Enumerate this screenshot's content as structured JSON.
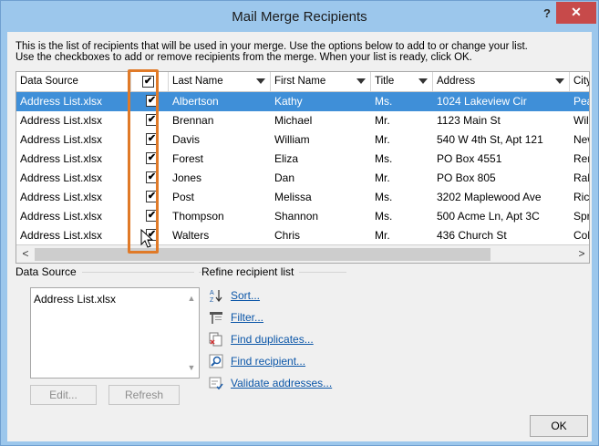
{
  "window": {
    "title": "Mail Merge Recipients",
    "help_label": "?",
    "close_label": "✕"
  },
  "intro_text": [
    "This is the list of recipients that will be used in your merge.  Use the options below to add to or change your list.",
    "Use the checkboxes to add or remove recipients from the merge.  When your list is ready, click OK."
  ],
  "table": {
    "columns": [
      "Data Source",
      "",
      "Last Name",
      "First Name",
      "Title",
      "Address",
      "City"
    ],
    "rows": [
      {
        "source": "Address List.xlsx",
        "checked": "✔",
        "last": "Albertson",
        "first": "Kathy",
        "title": "Ms.",
        "address": "1024 Lakeview Cir",
        "city": "Peacht"
      },
      {
        "source": "Address List.xlsx",
        "checked": "✔",
        "last": "Brennan",
        "first": "Michael",
        "title": "Mr.",
        "address": "1123 Main St",
        "city": "Wilmin"
      },
      {
        "source": "Address List.xlsx",
        "checked": "✔",
        "last": "Davis",
        "first": "William",
        "title": "Mr.",
        "address": "540 W 4th St, Apt 121",
        "city": "New Y"
      },
      {
        "source": "Address List.xlsx",
        "checked": "✔",
        "last": "Forest",
        "first": "Eliza",
        "title": "Ms.",
        "address": "PO Box 4551",
        "city": "Reno"
      },
      {
        "source": "Address List.xlsx",
        "checked": "✔",
        "last": "Jones",
        "first": "Dan",
        "title": "Mr.",
        "address": "PO Box 805",
        "city": "Raleigh"
      },
      {
        "source": "Address List.xlsx",
        "checked": "✔",
        "last": "Post",
        "first": "Melissa",
        "title": "Ms.",
        "address": "3202 Maplewood Ave",
        "city": "Richm"
      },
      {
        "source": "Address List.xlsx",
        "checked": "✔",
        "last": "Thompson",
        "first": "Shannon",
        "title": "Ms.",
        "address": "500 Acme Ln, Apt 3C",
        "city": "Spring"
      },
      {
        "source": "Address List.xlsx",
        "checked": "✔",
        "last": "Walters",
        "first": "Chris",
        "title": "Mr.",
        "address": "436 Church St",
        "city": "Colum"
      }
    ],
    "selected_row": 0,
    "header_check": "✔",
    "scroll_left": "<",
    "scroll_right": ">"
  },
  "data_source": {
    "label": "Data Source",
    "items": [
      "Address List.xlsx"
    ],
    "edit_label": "Edit...",
    "refresh_label": "Refresh"
  },
  "refine": {
    "label": "Refine recipient list",
    "links": [
      {
        "label": "Sort...",
        "icon": "sort-icon"
      },
      {
        "label": "Filter...",
        "icon": "filter-icon"
      },
      {
        "label": "Find duplicates...",
        "icon": "find-duplicates-icon"
      },
      {
        "label": "Find recipient...",
        "icon": "find-recipient-icon"
      },
      {
        "label": "Validate addresses...",
        "icon": "validate-addresses-icon"
      }
    ]
  },
  "ok_label": "OK",
  "colors": {
    "title_bar": "#9cc7ec",
    "selection": "#3f8fd8",
    "highlight": "#e07a28",
    "link": "#0b56a8",
    "close": "#c74a4a"
  }
}
